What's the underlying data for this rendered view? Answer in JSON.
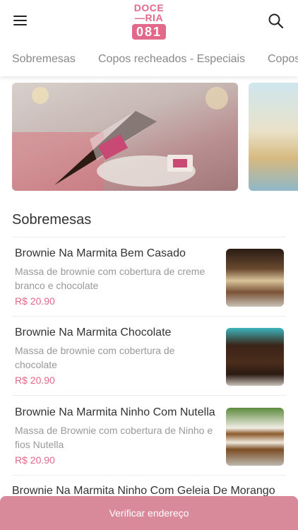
{
  "header": {
    "logo_line1": "DOCE",
    "logo_line2": "—RIA",
    "logo_number": "081",
    "menu_icon": "hamburger-menu-icon",
    "search_icon": "search-icon"
  },
  "tabs": [
    {
      "label": "Sobremesas"
    },
    {
      "label": "Copos recheados - Especiais"
    },
    {
      "label": "Copos"
    }
  ],
  "section": {
    "title": "Sobremesas"
  },
  "items": [
    {
      "name": "Brownie Na Marmita Bem Casado",
      "description": "Massa de brownie com cobertura de creme branco e chocolate",
      "price": "R$ 20.90"
    },
    {
      "name": "Brownie Na Marmita Chocolate",
      "description": "Massa de brownie com cobertura de chocolate",
      "price": "R$ 20.90"
    },
    {
      "name": "Brownie Na Marmita Ninho Com Nutella",
      "description": "Massa de Brownie com cobertura de Ninho e fios Nutella",
      "price": "R$ 20.90"
    },
    {
      "name": "Brownie Na Marmita Ninho Com Geleia De Morango"
    }
  ],
  "footer": {
    "cta_label": "Verificar endereço"
  },
  "colors": {
    "accent": "#e2698a",
    "cta_background": "#d98a9a"
  }
}
